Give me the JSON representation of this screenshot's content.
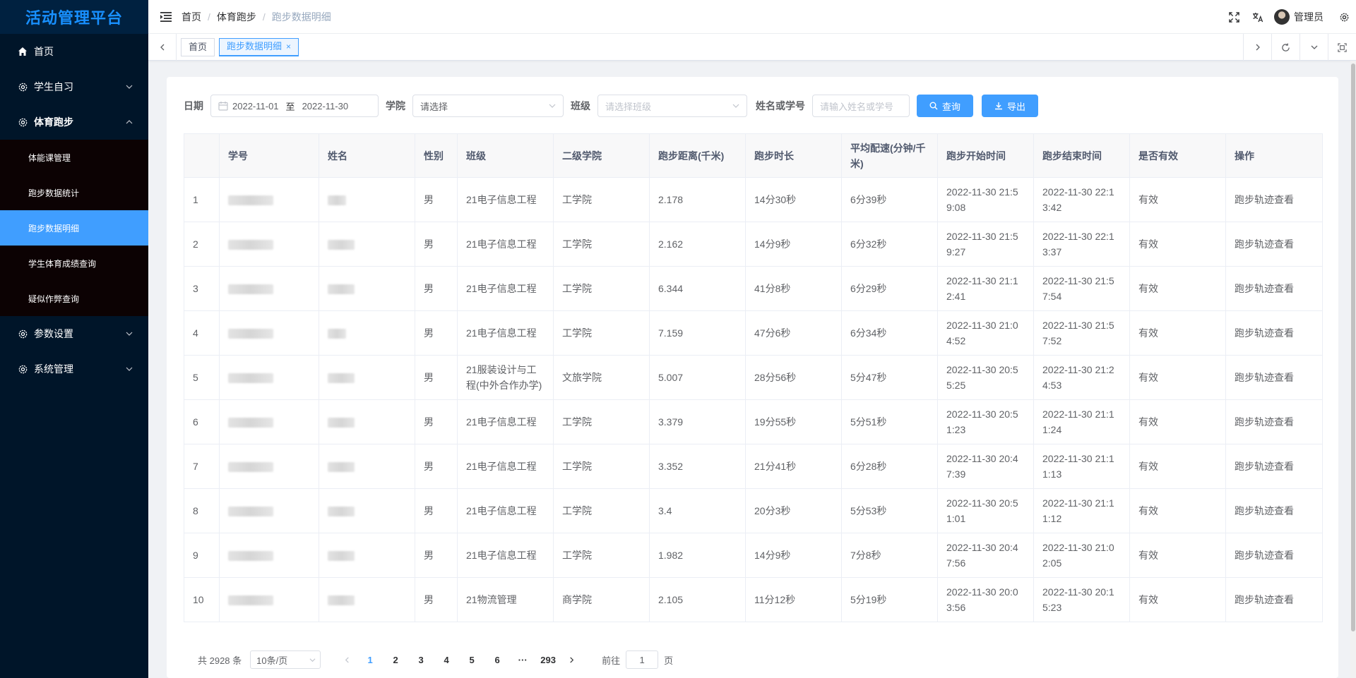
{
  "app": {
    "title": "活动管理平台"
  },
  "sidebar": {
    "items": [
      {
        "label": "首页",
        "icon": "home-icon"
      },
      {
        "label": "学生自习",
        "icon": "gear-icon"
      },
      {
        "label": "体育跑步",
        "icon": "gear-icon",
        "open": true,
        "children": [
          "体能课管理",
          "跑步数据统计",
          "跑步数据明细",
          "学生体育成绩查询",
          "疑似作弊查询"
        ]
      },
      {
        "label": "参数设置",
        "icon": "gear-icon"
      },
      {
        "label": "系统管理",
        "icon": "gear-icon"
      }
    ],
    "active_child": "跑步数据明细"
  },
  "header": {
    "breadcrumb": [
      "首页",
      "体育跑步",
      "跑步数据明细"
    ],
    "user_name": "管理员"
  },
  "tags": [
    {
      "label": "首页",
      "active": false
    },
    {
      "label": "跑步数据明细",
      "active": true,
      "close": "×"
    }
  ],
  "filter": {
    "date_label": "日期",
    "date_start": "2022-11-01",
    "date_sep": "至",
    "date_end": "2022-11-30",
    "college_label": "学院",
    "college_placeholder": "请选择",
    "class_label": "班级",
    "class_placeholder": "请选择班级",
    "name_label": "姓名或学号",
    "name_placeholder": "请输入姓名或学号",
    "query_button": "查询",
    "export_button": "导出"
  },
  "table": {
    "headers": [
      "",
      "学号",
      "姓名",
      "性别",
      "班级",
      "二级学院",
      "跑步距离(千米)",
      "跑步时长",
      "平均配速(分钟/千米)",
      "跑步开始时间",
      "跑步结束时间",
      "是否有效",
      "操作"
    ],
    "rows": [
      {
        "idx": "1",
        "gender": "男",
        "class": "21电子信息工程",
        "college": "工学院",
        "distance": "2.178",
        "duration": "14分30秒",
        "pace": "6分39秒",
        "start": "2022-11-30 21:59:08",
        "end": "2022-11-30 22:13:42",
        "valid": "有效",
        "action": "跑步轨迹查看"
      },
      {
        "idx": "2",
        "gender": "男",
        "class": "21电子信息工程",
        "college": "工学院",
        "distance": "2.162",
        "duration": "14分9秒",
        "pace": "6分32秒",
        "start": "2022-11-30 21:59:27",
        "end": "2022-11-30 22:13:37",
        "valid": "有效",
        "action": "跑步轨迹查看"
      },
      {
        "idx": "3",
        "gender": "男",
        "class": "21电子信息工程",
        "college": "工学院",
        "distance": "6.344",
        "duration": "41分8秒",
        "pace": "6分29秒",
        "start": "2022-11-30 21:12:41",
        "end": "2022-11-30 21:57:54",
        "valid": "有效",
        "action": "跑步轨迹查看"
      },
      {
        "idx": "4",
        "gender": "男",
        "class": "21电子信息工程",
        "college": "工学院",
        "distance": "7.159",
        "duration": "47分6秒",
        "pace": "6分34秒",
        "start": "2022-11-30 21:04:52",
        "end": "2022-11-30 21:57:52",
        "valid": "有效",
        "action": "跑步轨迹查看"
      },
      {
        "idx": "5",
        "gender": "男",
        "class": "21服装设计与工程(中外合作办学)",
        "college": "文旅学院",
        "distance": "5.007",
        "duration": "28分56秒",
        "pace": "5分47秒",
        "start": "2022-11-30 20:55:25",
        "end": "2022-11-30 21:24:53",
        "valid": "有效",
        "action": "跑步轨迹查看"
      },
      {
        "idx": "6",
        "gender": "男",
        "class": "21电子信息工程",
        "college": "工学院",
        "distance": "3.379",
        "duration": "19分55秒",
        "pace": "5分51秒",
        "start": "2022-11-30 20:51:23",
        "end": "2022-11-30 21:11:24",
        "valid": "有效",
        "action": "跑步轨迹查看"
      },
      {
        "idx": "7",
        "gender": "男",
        "class": "21电子信息工程",
        "college": "工学院",
        "distance": "3.352",
        "duration": "21分41秒",
        "pace": "6分28秒",
        "start": "2022-11-30 20:47:39",
        "end": "2022-11-30 21:11:13",
        "valid": "有效",
        "action": "跑步轨迹查看"
      },
      {
        "idx": "8",
        "gender": "男",
        "class": "21电子信息工程",
        "college": "工学院",
        "distance": "3.4",
        "duration": "20分3秒",
        "pace": "5分53秒",
        "start": "2022-11-30 20:51:01",
        "end": "2022-11-30 21:11:12",
        "valid": "有效",
        "action": "跑步轨迹查看"
      },
      {
        "idx": "9",
        "gender": "男",
        "class": "21电子信息工程",
        "college": "工学院",
        "distance": "1.982",
        "duration": "14分9秒",
        "pace": "7分8秒",
        "start": "2022-11-30 20:47:56",
        "end": "2022-11-30 21:02:05",
        "valid": "有效",
        "action": "跑步轨迹查看"
      },
      {
        "idx": "10",
        "gender": "男",
        "class": "21物流管理",
        "college": "商学院",
        "distance": "2.105",
        "duration": "11分12秒",
        "pace": "5分19秒",
        "start": "2022-11-30 20:03:56",
        "end": "2022-11-30 20:15:23",
        "valid": "有效",
        "action": "跑步轨迹查看"
      }
    ]
  },
  "pagination": {
    "total": "共 2928 条",
    "page_size": "10条/页",
    "pages": [
      "1",
      "2",
      "3",
      "4",
      "5",
      "6",
      "···",
      "293"
    ],
    "current": "1",
    "goto_label": "前往",
    "goto_value": "1",
    "goto_suffix": "页"
  },
  "colors": {
    "primary": "#409eff",
    "sidebar_bg": "#001529",
    "submenu_bg": "#0c0203",
    "valid": "#e6a23c"
  }
}
